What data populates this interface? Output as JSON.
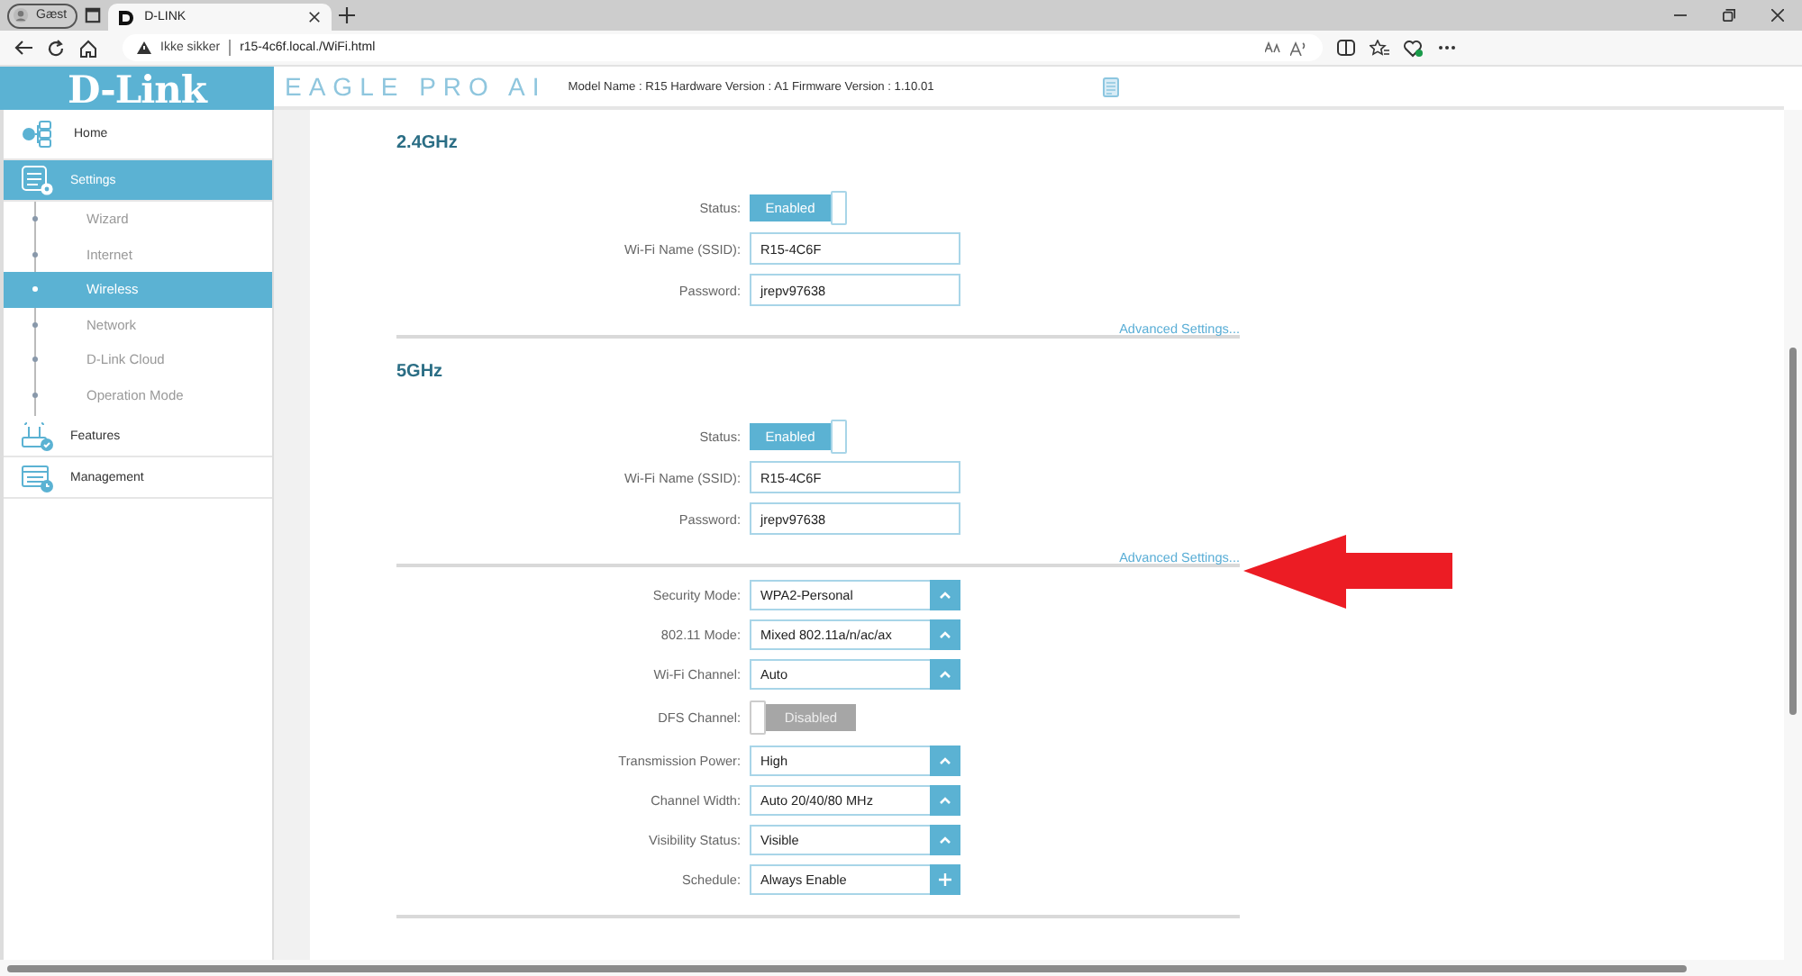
{
  "browser": {
    "profile": "Gæst",
    "tab_title": "D-LINK",
    "security": "Ikke sikker",
    "url": "r15-4c6f.local./WiFi.html"
  },
  "header": {
    "logo": "D-Link",
    "brand": "EAGLE PRO AI",
    "model_info": "Model Name : R15 Hardware Version : A1 Firmware Version : 1.10.01"
  },
  "sidebar": {
    "items": [
      {
        "label": "Home",
        "kind": "home",
        "selected": false
      },
      {
        "label": "Settings",
        "kind": "settings",
        "selected": true,
        "children": [
          {
            "label": "Wizard",
            "selected": false
          },
          {
            "label": "Internet",
            "selected": false
          },
          {
            "label": "Wireless",
            "selected": true
          },
          {
            "label": "Network",
            "selected": false
          },
          {
            "label": "D-Link Cloud",
            "selected": false
          },
          {
            "label": "Operation Mode",
            "selected": false
          }
        ]
      },
      {
        "label": "Features",
        "kind": "features",
        "selected": false
      },
      {
        "label": "Management",
        "kind": "management",
        "selected": false
      }
    ]
  },
  "sections": [
    {
      "title": "2.4GHz",
      "rows": [
        {
          "kind": "toggle",
          "label": "Status:",
          "value": "Enabled",
          "on": true
        },
        {
          "kind": "text",
          "label": "Wi-Fi Name (SSID):",
          "value": "R15-4C6F"
        },
        {
          "kind": "text",
          "label": "Password:",
          "value": "jrepv97638"
        }
      ],
      "link": "Advanced Settings..."
    },
    {
      "title": "5GHz",
      "rows": [
        {
          "kind": "toggle",
          "label": "Status:",
          "value": "Enabled",
          "on": true
        },
        {
          "kind": "text",
          "label": "Wi-Fi Name (SSID):",
          "value": "R15-4C6F"
        },
        {
          "kind": "text",
          "label": "Password:",
          "value": "jrepv97638"
        }
      ],
      "link": "Advanced Settings..."
    }
  ],
  "advanced_rows": [
    {
      "kind": "select",
      "label": "Security Mode:",
      "value": "WPA2-Personal"
    },
    {
      "kind": "select",
      "label": "802.11 Mode:",
      "value": "Mixed 802.11a/n/ac/ax"
    },
    {
      "kind": "select",
      "label": "Wi-Fi Channel:",
      "value": "Auto"
    },
    {
      "kind": "toggle",
      "label": "DFS Channel:",
      "value": "Disabled",
      "on": false
    },
    {
      "kind": "select",
      "label": "Transmission Power:",
      "value": "High"
    },
    {
      "kind": "select",
      "label": "Channel Width:",
      "value": "Auto 20/40/80 MHz"
    },
    {
      "kind": "select",
      "label": "Visibility Status:",
      "value": "Visible"
    },
    {
      "kind": "add",
      "label": "Schedule:",
      "value": "Always Enable"
    }
  ]
}
